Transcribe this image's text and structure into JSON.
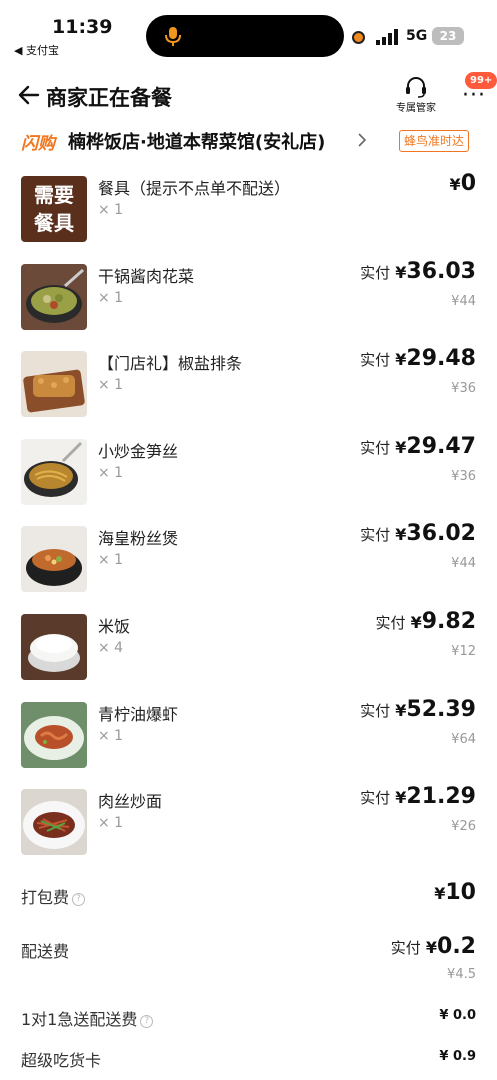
{
  "status_bar": {
    "time": "11:39",
    "back_app": "◀ 支付宝",
    "network": "5G",
    "battery": "23"
  },
  "header": {
    "title": "商家正在备餐",
    "steward_label": "专属管家",
    "more_badge": "99+"
  },
  "store": {
    "flash_label": "闪购",
    "name": "楠桦饭店·地道本帮菜馆(安礼店)",
    "tag": "蜂鸟准时达"
  },
  "paid_label": "实付",
  "currency": "¥",
  "items": [
    {
      "name": "餐具（提示不点单不配送）",
      "qty": "× 1",
      "paid": "0",
      "original": "",
      "thumb_text": "需要餐具"
    },
    {
      "name": "干锅酱肉花菜",
      "qty": "× 1",
      "paid": "36.03",
      "original": "¥44"
    },
    {
      "name": "【门店礼】椒盐排条",
      "qty": "× 1",
      "paid": "29.48",
      "original": "¥36"
    },
    {
      "name": "小炒金笋丝",
      "qty": "× 1",
      "paid": "29.47",
      "original": "¥36"
    },
    {
      "name": "海皇粉丝煲",
      "qty": "× 1",
      "paid": "36.02",
      "original": "¥44"
    },
    {
      "name": "米饭",
      "qty": "× 4",
      "paid": "9.82",
      "original": "¥12"
    },
    {
      "name": "青柠油爆虾",
      "qty": "× 1",
      "paid": "52.39",
      "original": "¥64"
    },
    {
      "name": "肉丝炒面",
      "qty": "× 1",
      "paid": "21.29",
      "original": "¥26"
    }
  ],
  "fees": {
    "packing": {
      "label": "打包费",
      "value": "10"
    },
    "delivery": {
      "label": "配送费",
      "value": "0.2",
      "original": "¥4.5"
    },
    "express": {
      "label": "1对1急送配送费",
      "value": "¥ 0.0"
    },
    "foodie_card": {
      "label": "超级吃货卡",
      "value": "¥ 0.9"
    }
  },
  "colors": {
    "accent_orange": "#f0771f",
    "badge_red": "#ff5a3c"
  }
}
